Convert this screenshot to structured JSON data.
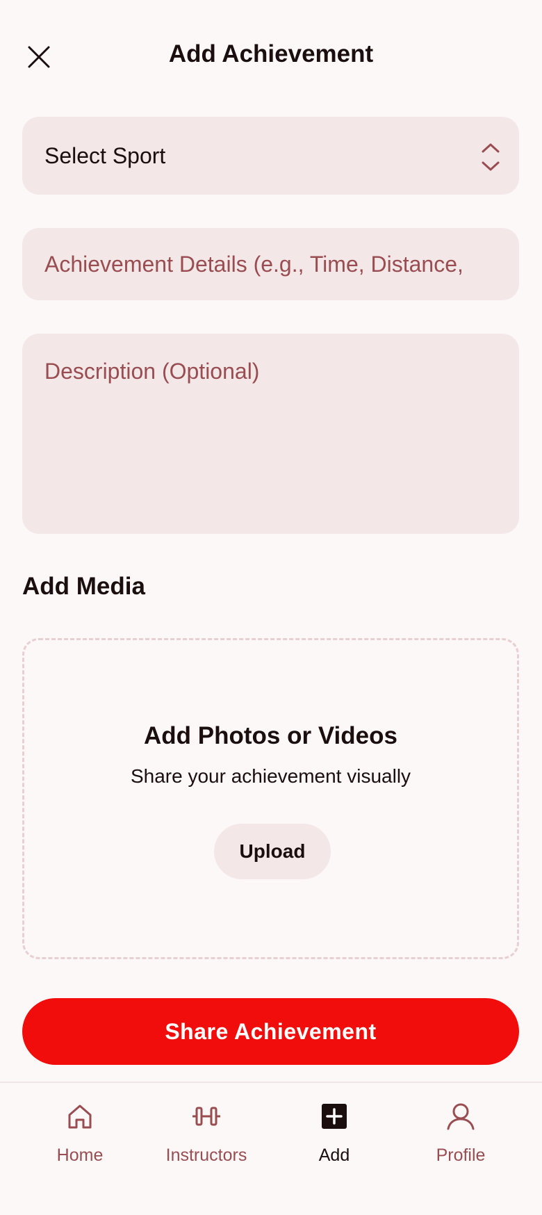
{
  "header": {
    "title": "Add Achievement",
    "close_icon": "close-icon"
  },
  "form": {
    "sport_select": {
      "value": "Select Sport",
      "icon": "chevron-up-down-icon"
    },
    "details_placeholder": "Achievement Details (e.g., Time, Distance,",
    "description_placeholder": "Description (Optional)"
  },
  "media": {
    "section_title": "Add Media",
    "upload_title": "Add Photos or Videos",
    "upload_subtitle": "Share your achievement visually",
    "upload_button": "Upload"
  },
  "share_button": "Share Achievement",
  "nav": {
    "items": [
      {
        "label": "Home",
        "icon": "home-icon",
        "active": false
      },
      {
        "label": "Instructors",
        "icon": "dumbbell-icon",
        "active": false
      },
      {
        "label": "Add",
        "icon": "add-square-icon",
        "active": true
      },
      {
        "label": "Profile",
        "icon": "user-icon",
        "active": false
      }
    ]
  },
  "colors": {
    "background": "#fcf8f8",
    "field_bg": "#f3e7e8",
    "text": "#1b0e0e",
    "muted": "#994d51",
    "accent": "#f20d0d",
    "dashed_border": "#e7cfd2"
  }
}
